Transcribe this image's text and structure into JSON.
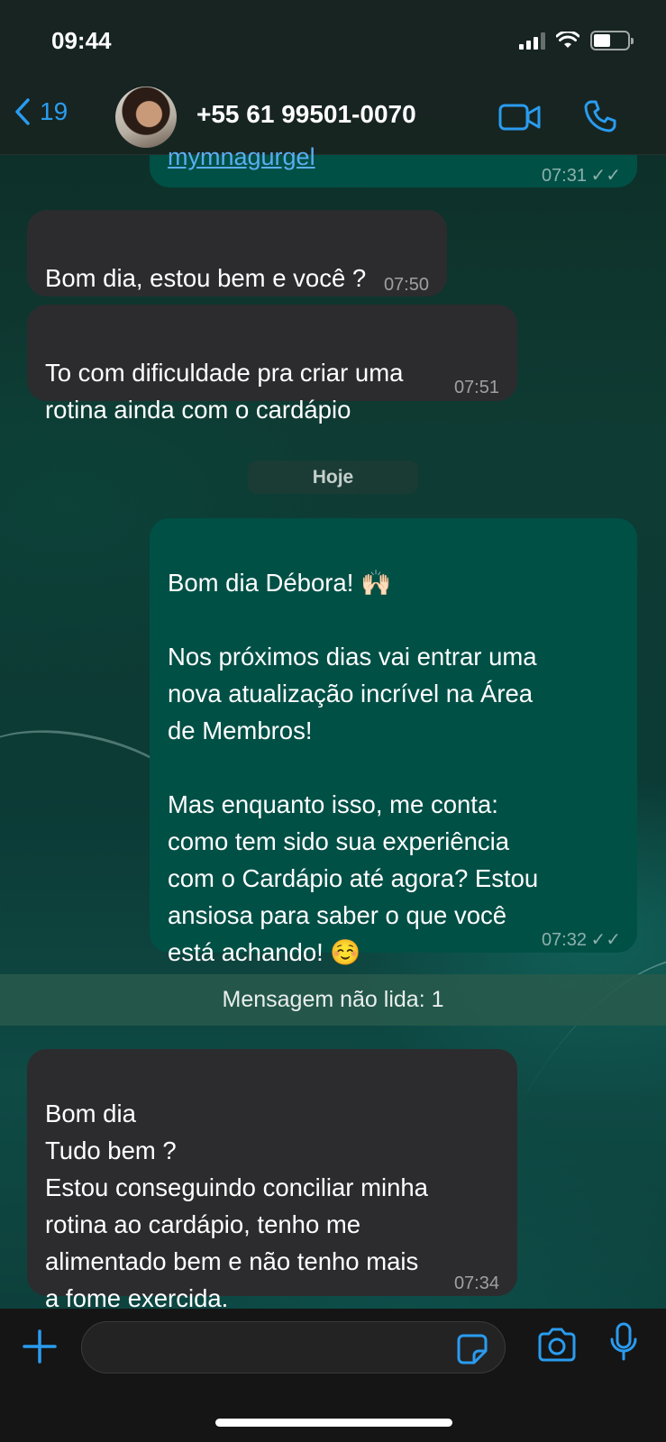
{
  "status": {
    "time": "09:44"
  },
  "header": {
    "back_count": "19",
    "contact": "+55 61 99501-0070"
  },
  "messages": {
    "m0": {
      "link_text": "mymnagurgel",
      "time": "07:31",
      "ticks": "✓✓"
    },
    "m1": {
      "text": "Bom dia, estou bem e você ?",
      "time": "07:50"
    },
    "m2": {
      "text": "To com dificuldade pra criar uma\nrotina ainda com o cardápio",
      "time": "07:51"
    },
    "day_divider": "Hoje",
    "m3": {
      "text": "Bom dia Débora! 🙌🏻\n\nNos próximos dias vai entrar uma\nnova atualização incrível na Área\nde Membros!\n\nMas enquanto isso, me conta:\ncomo tem sido sua experiência\ncom o Cardápio até agora? Estou\nansiosa para saber o que você\nestá achando! ☺️",
      "time": "07:32",
      "ticks": "✓✓"
    },
    "unread_label": "Mensagem não lida: 1",
    "m4": {
      "text": "Bom dia\nTudo bem ?\nEstou conseguindo conciliar minha\nrotina ao cardápio, tenho me\nalimentado bem e não tenho mais\na fome exercida.",
      "time": "07:34"
    }
  },
  "colors": {
    "accent": "#2a9cf0",
    "incoming_bubble": "#2c2c2e",
    "outgoing_bubble": "#005046"
  },
  "icons": [
    "back-chevron-icon",
    "video-call-icon",
    "phone-icon",
    "plus-icon",
    "sticker-icon",
    "camera-icon",
    "microphone-icon"
  ]
}
